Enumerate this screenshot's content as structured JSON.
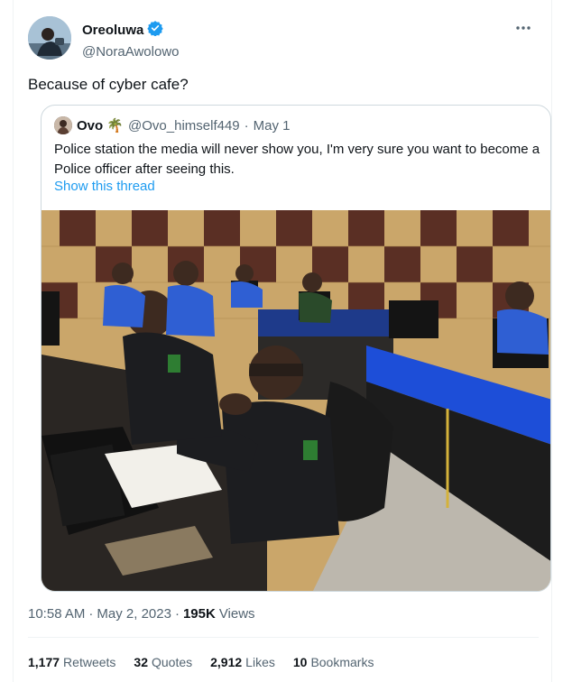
{
  "author": {
    "display_name": "Oreoluwa",
    "handle": "@NoraAwolowo",
    "verified": true,
    "badge_color": "#1d9bf0"
  },
  "tweet": {
    "text": "Because of cyber cafe?"
  },
  "quoted": {
    "display_name": "Ovo 🌴",
    "handle": "@Ovo_himself449",
    "separator": "·",
    "date": "May 1",
    "text": "Police station the media will never show you, I'm very sure you want to become a Police officer after seeing this.",
    "show_thread": "Show this thread"
  },
  "meta": {
    "time": "10:58 AM",
    "dot": "·",
    "date": "May 2, 2023",
    "views_count": "195K",
    "views_label": "Views"
  },
  "stats": {
    "retweets_count": "1,177",
    "retweets_label": "Retweets",
    "quotes_count": "32",
    "quotes_label": "Quotes",
    "likes_count": "2,912",
    "likes_label": "Likes",
    "bookmarks_count": "10",
    "bookmarks_label": "Bookmarks"
  },
  "icons": {
    "more": "more-horizontal-icon",
    "verified": "verified-badge-icon"
  },
  "colors": {
    "link": "#1d9bf0",
    "secondary_text": "#536471",
    "border": "#cfd9de"
  }
}
